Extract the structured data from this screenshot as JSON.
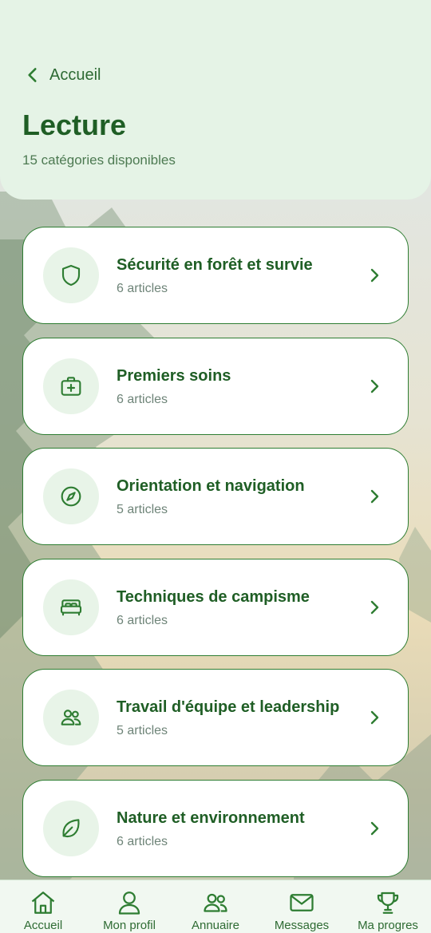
{
  "header": {
    "back_label": "Accueil",
    "title": "Lecture",
    "subtitle": "15 catégories disponibles"
  },
  "categories": [
    {
      "title": "Sécurité en forêt et survie",
      "count": "6 articles",
      "icon": "shield-icon"
    },
    {
      "title": "Premiers soins",
      "count": "6 articles",
      "icon": "first-aid-kit-icon"
    },
    {
      "title": "Orientation et navigation",
      "count": "5 articles",
      "icon": "compass-icon"
    },
    {
      "title": "Techniques de campisme",
      "count": "6 articles",
      "icon": "bed-icon"
    },
    {
      "title": "Travail d'équipe et leadership",
      "count": "5 articles",
      "icon": "users-icon"
    },
    {
      "title": "Nature et environnement",
      "count": "6 articles",
      "icon": "leaf-icon"
    }
  ],
  "tabbar": {
    "items": [
      {
        "label": "Accueil",
        "icon": "home-icon"
      },
      {
        "label": "Mon profil",
        "icon": "user-icon"
      },
      {
        "label": "Annuaire",
        "icon": "users-icon"
      },
      {
        "label": "Messages",
        "icon": "mail-icon"
      },
      {
        "label": "Ma progres",
        "icon": "trophy-icon"
      }
    ]
  },
  "colors": {
    "accent": "#2e7d32",
    "title_green": "#1f5e25",
    "header_bg": "#e5f3e6",
    "icon_circle_bg": "#e8f4e8",
    "muted_text": "#6e8478"
  }
}
